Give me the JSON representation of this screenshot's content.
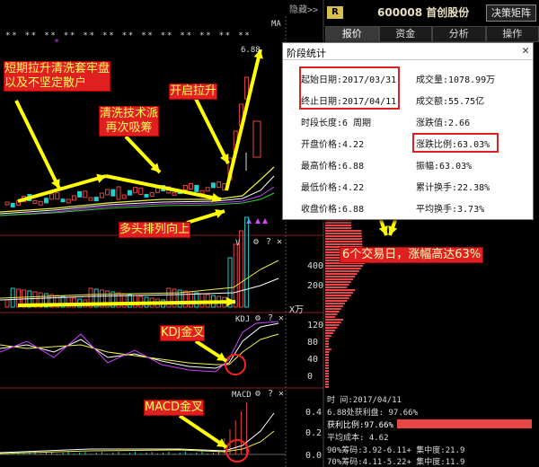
{
  "toolbar": {
    "hide_label": "隐藏>>"
  },
  "header": {
    "badge": "R",
    "stock_title": "600008 首创股份",
    "decision_button": "决策矩阵"
  },
  "tabs": [
    {
      "label": "报价",
      "active": true
    },
    {
      "label": "资金",
      "active": false
    },
    {
      "label": "分析",
      "active": false
    },
    {
      "label": "操作",
      "active": false
    }
  ],
  "main_chart": {
    "ma_label": "MA",
    "top_price": "6.88",
    "star_rows": "**  **  *  ***   *  *  ****  *******  *"
  },
  "volume_panel": {
    "label": "V",
    "axis": [
      "400",
      "200"
    ],
    "unit": "X万"
  },
  "kdj_panel": {
    "label": "KDJ",
    "axis": [
      "120",
      "80",
      "40",
      "0"
    ]
  },
  "macd_panel": {
    "label": "MACD",
    "axis": [
      "0.4",
      "0.2",
      "0.0"
    ]
  },
  "dialog": {
    "title": "阶段统计",
    "close": "✕",
    "rows": [
      {
        "left": "起始日期:2017/03/31",
        "right": "成交量:1078.99万"
      },
      {
        "left": "终止日期:2017/04/11",
        "right": "成交额:55.75亿"
      },
      {
        "left": "时段长度:6 周期",
        "right": "涨跌值:2.66"
      },
      {
        "left": "开盘价格:4.22",
        "right": "涨跌比例:63.03%"
      },
      {
        "left": "最高价格:6.88",
        "right": "振幅:63.03%"
      },
      {
        "left": "最低价格:4.22",
        "right": "累计换手:22.38%"
      },
      {
        "left": "收盘价格:6.88",
        "right": "平均换手:3.73%"
      }
    ]
  },
  "bottom_stats": [
    "时      间:2017/04/11",
    "6.88处获利盘: 97.66%",
    "获利比例:97.66%",
    "平均成本: 4.62",
    "90%筹码:3.92-6.11+ 集中度:21.9",
    "70%筹码:4.11-5.22+ 集中度:11.9"
  ],
  "annotations": {
    "shake_out": "短期拉升清洗套牢盘\n以及不坚定散户",
    "clean_tech": "清洗技术派\n再次吸筹",
    "start_rise": "开启拉升",
    "bull_align": "多头排列向上",
    "kdj_cross": "KDJ金叉",
    "macd_cross": "MACD金叉",
    "six_days": "6个交易日，涨幅高达63%"
  },
  "colors": {
    "up": "#e84545",
    "down": "#20d0d0",
    "ma_yellow": "#f0f040",
    "ma_white": "#ffffff",
    "ma_purple": "#c040ff",
    "ma_green": "#30d030",
    "arrow": "#ffff00",
    "note_bg": "#e02020"
  }
}
